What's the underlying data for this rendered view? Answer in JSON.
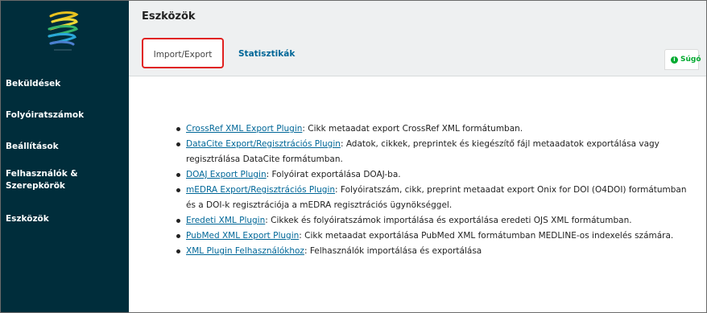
{
  "sidebar": {
    "logo_icon": "ojs-logo-icon",
    "items": [
      {
        "label": "Beküldések"
      },
      {
        "label": "Folyóiratszámok"
      },
      {
        "label": "Beállítások"
      },
      {
        "label": "Felhasználók &"
      },
      {
        "label": "Szerepkörök"
      },
      {
        "label": "Eszközök"
      }
    ]
  },
  "header": {
    "title": "Eszközök",
    "tabs": [
      {
        "label": "Import/Export"
      },
      {
        "label": "Statisztikák"
      }
    ],
    "help": {
      "label": "Súgó",
      "icon": "info-icon"
    }
  },
  "plugins": [
    {
      "name": "CrossRef XML Export Plugin",
      "desc": ": Cikk metaadat export CrossRef XML formátumban."
    },
    {
      "name": "DataCite Export/Regisztrációs Plugin",
      "desc": ": Adatok, cikkek, preprintek és kiegészítő fájl metaadatok exportálása vagy regisztrálása DataCite formátumban."
    },
    {
      "name": "DOAJ Export Plugin",
      "desc": ": Folyóirat exportálása DOAJ-ba."
    },
    {
      "name": "mEDRA Export/Regisztrációs Plugin",
      "desc": ": Folyóiratszám, cikk, preprint metaadat export Onix for DOI (O4DOI) formátumban és a DOI-k regisztrációja a mEDRA regisztrációs ügynökséggel."
    },
    {
      "name": "Eredeti XML Plugin",
      "desc": ": Cikkek és folyóiratszámok importálása és exportálása eredeti OJS XML formátumban."
    },
    {
      "name": "PubMed XML Export Plugin",
      "desc": ": Cikk metaadat exportálása PubMed XML formátumban MEDLINE-os indexelés számára."
    },
    {
      "name": "XML Plugin Felhasználókhoz",
      "desc": ": Felhasználók importálása és exportálása"
    }
  ],
  "colors": {
    "sidebar_bg": "#002d3b",
    "link": "#006798",
    "highlight_border": "#e0201f",
    "help_green": "#00aa2f"
  }
}
